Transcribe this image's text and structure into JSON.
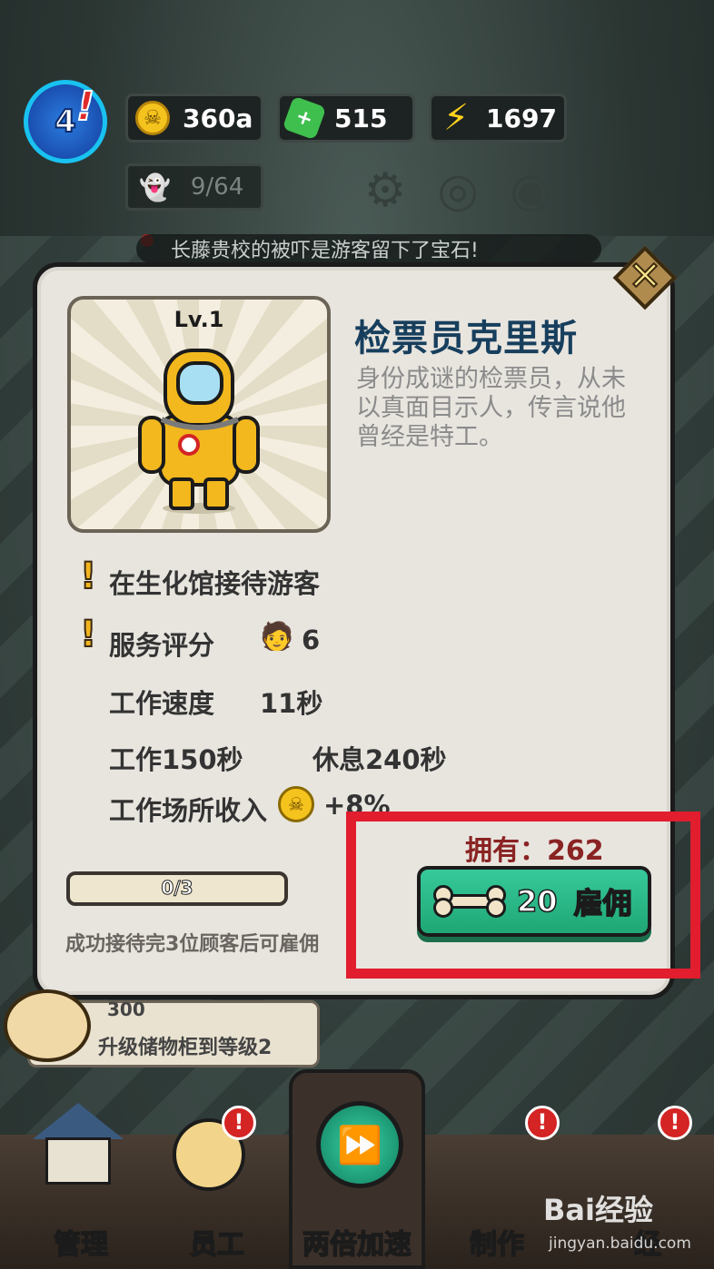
{
  "hud": {
    "level": "4",
    "coins": "360a",
    "gems": "515",
    "energy": "1697",
    "visitors": "9/64",
    "ticker": "长藤贵校的被吓是游客留下了宝石!"
  },
  "dialog": {
    "level_label": "Lv.1",
    "name": "检票员克里斯",
    "description": "身份成谜的检票员，从未以真面目示人，传言说他曾经是特工。",
    "stats": {
      "location": "在生化馆接待游客",
      "service_label": "服务评分",
      "service_value": "6",
      "speed_label": "工作速度",
      "speed_value": "11秒",
      "work_label": "工作150秒",
      "rest_label": "休息240秒",
      "income_label": "工作场所收入",
      "income_value": "+8%"
    },
    "own_label": "拥有：262",
    "hire_cost": "20",
    "hire_label": "雇佣",
    "progress_text": "0/3",
    "progress_fraction": 0,
    "condition": "成功接待完3位顾客后可雇佣"
  },
  "task": {
    "reward": "300",
    "text": "升级储物柜到等级2"
  },
  "nav": {
    "manage": "管理",
    "staff": "员工",
    "speed": "两倍加速",
    "craft": "制作",
    "fourth": "经"
  },
  "watermark": {
    "brand": "Bai经验",
    "url": "jingyan.baidu.com"
  },
  "colors": {
    "highlight": "#e11d2e",
    "hire_button": "#28b584",
    "name_color": "#173f5d"
  }
}
